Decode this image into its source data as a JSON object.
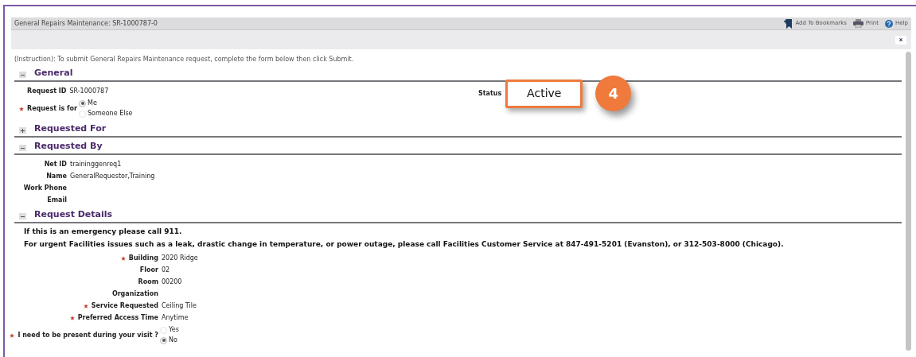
{
  "window": {
    "title": "General Repairs Maintenance: SR-1000787-0"
  },
  "toolbar": [
    {
      "kind": "bookmark",
      "label": "Add To Bookmarks"
    },
    {
      "kind": "print",
      "label": "Print"
    },
    {
      "kind": "help",
      "label": "Help"
    }
  ],
  "close_button": "x",
  "instruction": "(Instruction): To submit General Repairs Maintenance request, complete the form below then click Submit.",
  "sections": [
    {
      "title": "General",
      "expanded": true,
      "status": {
        "label": "Status",
        "value": "Active"
      },
      "fields": [
        {
          "kind": "text",
          "label": "Request ID",
          "value": "SR-1000787",
          "required": false
        },
        {
          "kind": "radio",
          "label": "Request is for",
          "required": true,
          "options": [
            {
              "label": "Me",
              "selected": true
            },
            {
              "label": "Someone Else",
              "selected": false
            }
          ]
        }
      ]
    },
    {
      "title": "Requested For",
      "expanded": false
    },
    {
      "title": "Requested By",
      "expanded": true,
      "fields": [
        {
          "kind": "text",
          "label": "Net ID",
          "value": "traininggenreq1",
          "required": false
        },
        {
          "kind": "text",
          "label": "Name",
          "value": "GeneralRequestor,Training",
          "required": false
        },
        {
          "kind": "text",
          "label": "Work Phone",
          "required": false
        },
        {
          "kind": "text",
          "label": "Email",
          "required": false
        }
      ]
    },
    {
      "title": "Request Details",
      "expanded": true,
      "fields": [
        {
          "kind": "notice",
          "text": "If this is an emergency please call 911."
        },
        {
          "kind": "notice",
          "text": "For urgent Facilities issues such as a leak, drastic change in temperature, or power outage, please call Facilities Customer Service at 847-491-5201 (Evanston), or 312-503-8000 (Chicago)."
        },
        {
          "kind": "text",
          "label": "Building",
          "value": "2020 Ridge",
          "required": true
        },
        {
          "kind": "text",
          "label": "Floor",
          "value": "02",
          "required": false
        },
        {
          "kind": "text",
          "label": "Room",
          "value": "00200",
          "required": false
        },
        {
          "kind": "text",
          "label": "Organization",
          "required": false
        },
        {
          "kind": "text",
          "label": "Service Requested",
          "value": "Ceiling Tile",
          "required": true
        },
        {
          "kind": "text",
          "label": "Preferred Access Time",
          "value": "Anytime",
          "required": true
        },
        {
          "kind": "radio",
          "label": "I need to be present during your visit ?",
          "required": true,
          "options": [
            {
              "label": "Yes",
              "selected": false
            },
            {
              "label": "No",
              "selected": true
            }
          ]
        }
      ]
    }
  ],
  "callout": {
    "number": "4"
  }
}
